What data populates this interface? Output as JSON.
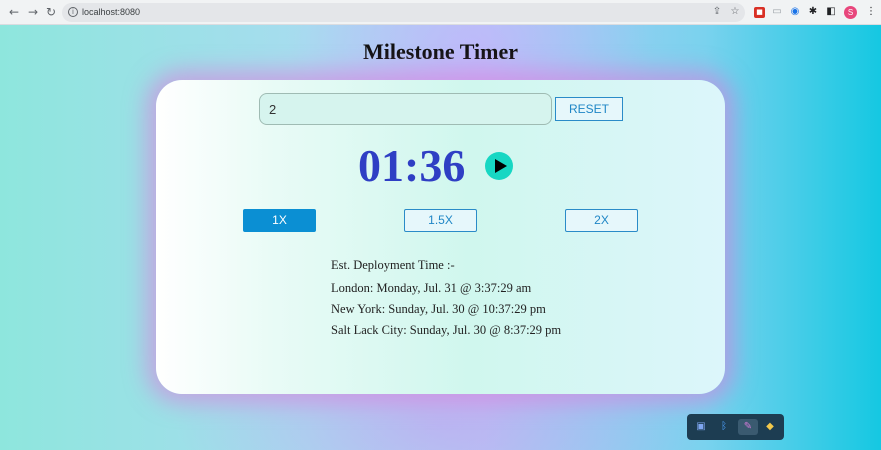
{
  "browser": {
    "url": "localhost:8080",
    "avatar_letter": "S",
    "icons": [
      "back-arrow-icon",
      "forward-arrow-icon",
      "reload-icon",
      "info-icon",
      "share-icon",
      "star-icon",
      "puzzle-icon",
      "side-panel-icon",
      "kebab-menu-icon"
    ]
  },
  "page": {
    "title": "Milestone Timer",
    "input": {
      "value": "2"
    },
    "reset_label": "RESET",
    "timer": "01:36",
    "speeds": [
      {
        "label": "1X",
        "active": true
      },
      {
        "label": "1.5X",
        "active": false
      },
      {
        "label": "2X",
        "active": false
      }
    ],
    "estimate": {
      "heading": "Est. Deployment Time :-",
      "lines": [
        "London: Monday, Jul. 31 @ 3:37:29 am",
        "New York: Sunday, Jul. 30 @ 10:37:29 pm",
        "Salt Lack City: Sunday, Jul. 30 @ 8:37:29 pm"
      ]
    }
  },
  "colors": {
    "timer": "#2f3fc4",
    "button_border": "#2a8bc8",
    "active_button": "#0b8fd3",
    "play_button": "#17d7c3"
  }
}
